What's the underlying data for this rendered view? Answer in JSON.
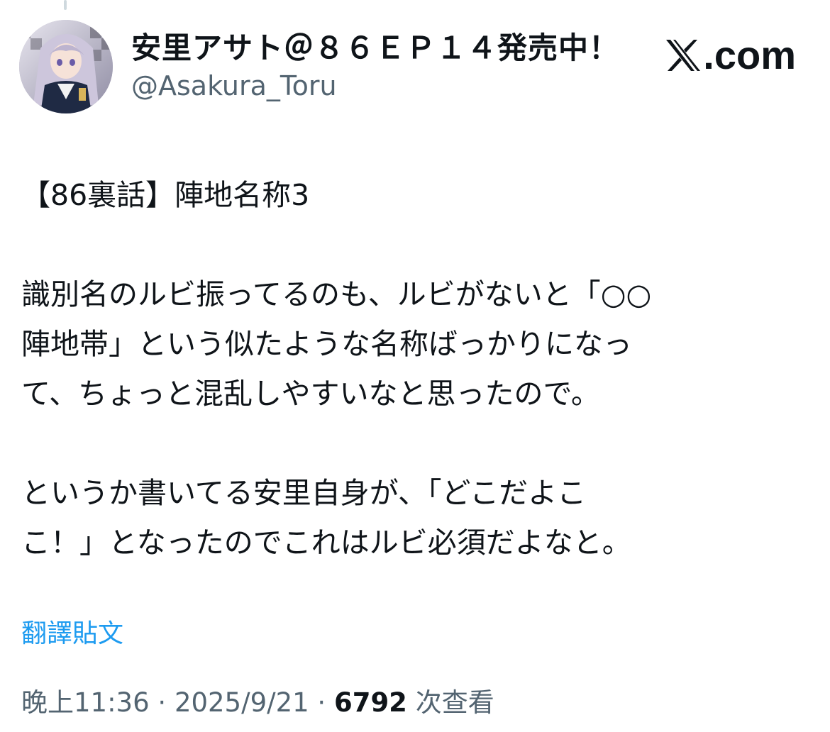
{
  "author": {
    "display_name": "安里アサト＠８６ＥＰ１４発売中！",
    "handle": "@Asakura_Toru"
  },
  "brand": {
    "domain_suffix": ".com"
  },
  "tweet": {
    "paragraphs": [
      "【86裏話】陣地名称3",
      "識別名のルビ振ってるのも、ルビがないと「○○\n陣地帯」という似たような名称ばっかりになっ\nて、ちょっと混乱しやすいなと思ったので。",
      "というか書いてる安里自身が、「どこだよこ\nこ！」となったのでこれはルビ必須だよなと。"
    ],
    "translate_label": "翻譯貼文"
  },
  "meta": {
    "time": "晚上11:36",
    "separator": " · ",
    "date": "2025/9/21",
    "views_count": "6792",
    "views_label": " 次查看"
  },
  "colors": {
    "text_primary": "#0f1419",
    "text_secondary": "#536471",
    "link": "#1d9bf0"
  }
}
